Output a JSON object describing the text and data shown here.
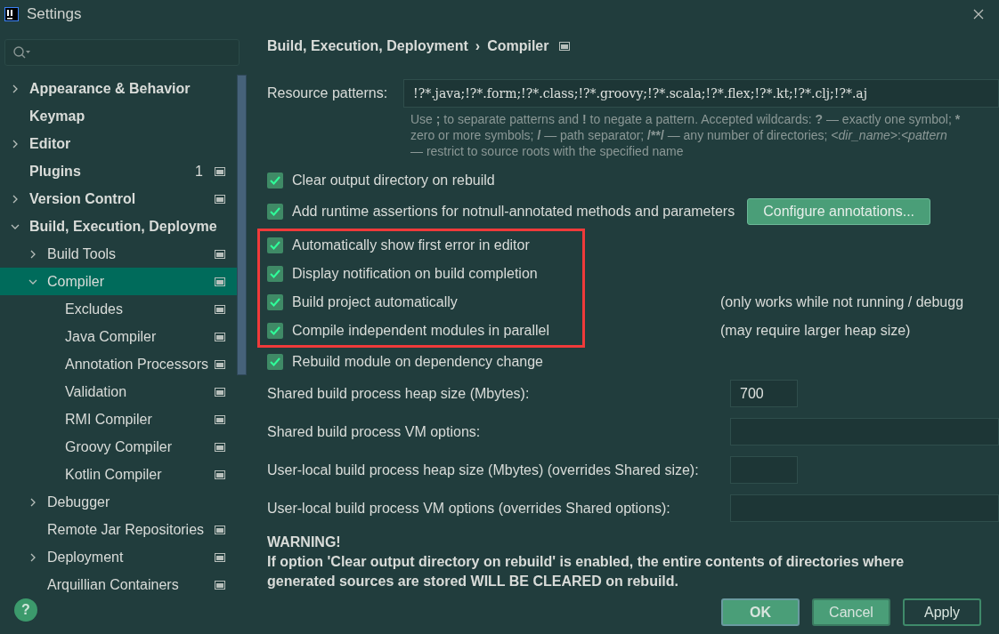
{
  "window": {
    "title": "Settings"
  },
  "tree": [
    {
      "label": "Appearance & Behavior",
      "expandable": true,
      "expanded": false,
      "selected": false,
      "project_icon": false
    },
    {
      "label": "Keymap",
      "expandable": false,
      "selected": false,
      "project_icon": false
    },
    {
      "label": "Editor",
      "expandable": true,
      "expanded": false,
      "selected": false,
      "project_icon": false
    },
    {
      "label": "Plugins",
      "expandable": false,
      "selected": false,
      "badge": "1",
      "project_icon": true
    },
    {
      "label": "Version Control",
      "expandable": true,
      "expanded": false,
      "selected": false,
      "project_icon": true
    },
    {
      "label": "Build, Execution, Deployme",
      "expandable": true,
      "expanded": true,
      "selected": false,
      "project_icon": false,
      "children": [
        {
          "label": "Build Tools",
          "expandable": true,
          "expanded": false,
          "selected": false,
          "project_icon": true
        },
        {
          "label": "Compiler",
          "expandable": true,
          "expanded": true,
          "selected": true,
          "project_icon": true,
          "children": [
            {
              "label": "Excludes",
              "expandable": false,
              "selected": false,
              "project_icon": true
            },
            {
              "label": "Java Compiler",
              "expandable": false,
              "selected": false,
              "project_icon": true
            },
            {
              "label": "Annotation Processors",
              "expandable": false,
              "selected": false,
              "project_icon": true
            },
            {
              "label": "Validation",
              "expandable": false,
              "selected": false,
              "project_icon": true
            },
            {
              "label": "RMI Compiler",
              "expandable": false,
              "selected": false,
              "project_icon": true
            },
            {
              "label": "Groovy Compiler",
              "expandable": false,
              "selected": false,
              "project_icon": true
            },
            {
              "label": "Kotlin Compiler",
              "expandable": false,
              "selected": false,
              "project_icon": true
            }
          ]
        },
        {
          "label": "Debugger",
          "expandable": true,
          "expanded": false,
          "selected": false,
          "project_icon": false
        },
        {
          "label": "Remote Jar Repositories",
          "expandable": false,
          "selected": false,
          "project_icon": true
        },
        {
          "label": "Deployment",
          "expandable": true,
          "expanded": false,
          "selected": false,
          "project_icon": true
        },
        {
          "label": "Arquillian Containers",
          "expandable": false,
          "selected": false,
          "project_icon": true
        }
      ]
    }
  ],
  "breadcrumb": {
    "parent": "Build, Execution, Deployment",
    "separator": "›",
    "current": "Compiler"
  },
  "resource_patterns": {
    "label": "Resource patterns:",
    "value": "!?*.java;!?*.form;!?*.class;!?*.groovy;!?*.scala;!?*.flex;!?*.kt;!?*.clj;!?*.aj",
    "hint_lines": [
      [
        {
          "text": "Use ",
          "kind": "text"
        },
        {
          "text": ";",
          "kind": "symbol"
        },
        {
          "text": " to separate patterns and ",
          "kind": "text"
        },
        {
          "text": "!",
          "kind": "symbol"
        },
        {
          "text": " to negate a pattern. Accepted wildcards: ",
          "kind": "text"
        },
        {
          "text": "?",
          "kind": "symbol"
        },
        {
          "text": " — exactly one symbol; ",
          "kind": "text"
        },
        {
          "text": "*",
          "kind": "symbol"
        }
      ],
      [
        {
          "text": "zero or more symbols; ",
          "kind": "text"
        },
        {
          "text": "/",
          "kind": "symbol"
        },
        {
          "text": " — path separator; ",
          "kind": "text"
        },
        {
          "text": "/**/",
          "kind": "symbol"
        },
        {
          "text": " — any number of directories; ",
          "kind": "text"
        },
        {
          "text": "<dir_name>",
          "kind": "parameter"
        },
        {
          "text": ":",
          "kind": "text"
        },
        {
          "text": "<pattern",
          "kind": "parameter"
        }
      ],
      [
        {
          "text": "— restrict to source roots with the specified name",
          "kind": "text"
        }
      ]
    ]
  },
  "options": [
    {
      "label": "Clear output directory on rebuild",
      "checked": true,
      "highlighted": false
    },
    {
      "label": "Add runtime assertions for notnull-annotated methods and parameters",
      "checked": true,
      "highlighted": false,
      "button": "Configure annotations..."
    },
    {
      "label": "Automatically show first error in editor",
      "checked": true,
      "highlighted": true
    },
    {
      "label": "Display notification on build completion",
      "checked": true,
      "highlighted": true
    },
    {
      "label": "Build project automatically",
      "checked": true,
      "highlighted": true,
      "note": "(only works while not running / debugg"
    },
    {
      "label": "Compile independent modules in parallel",
      "checked": true,
      "highlighted": true,
      "note": "(may require larger heap size)"
    },
    {
      "label": "Rebuild module on dependency change",
      "checked": true,
      "highlighted": false
    }
  ],
  "fields": [
    {
      "label": "Shared build process heap size (Mbytes):",
      "value": "700",
      "kind": "short"
    },
    {
      "label": "Shared build process VM options:",
      "kind": "wide"
    },
    {
      "label": "User-local build process heap size (Mbytes) (overrides Shared size):",
      "kind": "short"
    },
    {
      "label": "User-local build process VM options (overrides Shared options):",
      "kind": "wide"
    }
  ],
  "warning": {
    "title": "WARNING!",
    "text": "If option 'Clear output directory on rebuild' is enabled, the entire contents of directories where generated sources are stored WILL BE CLEARED on rebuild."
  },
  "help": "?",
  "buttons": [
    {
      "label": "OK",
      "kind": "default"
    },
    {
      "label": "Cancel",
      "kind": "primary"
    },
    {
      "label": "Apply",
      "kind": "outline"
    }
  ]
}
